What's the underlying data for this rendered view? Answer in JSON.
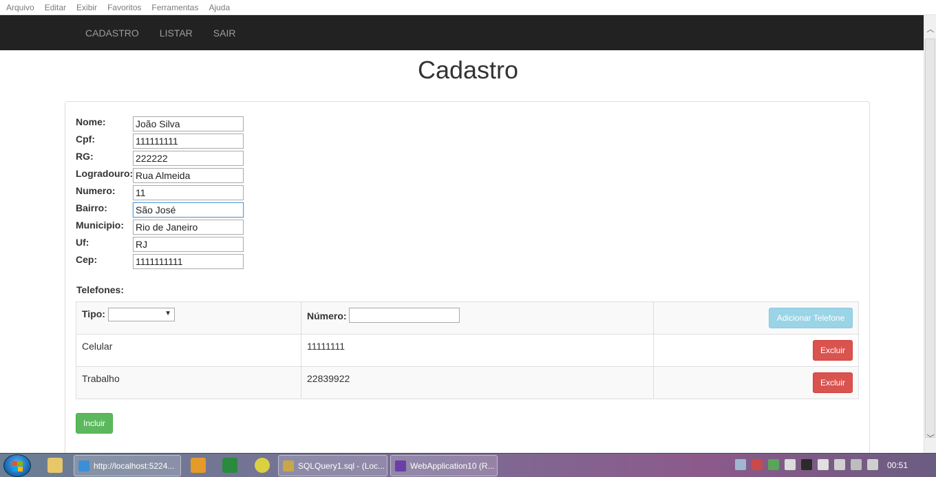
{
  "browser_menu": [
    "Arquivo",
    "Editar",
    "Exibir",
    "Favoritos",
    "Ferramentas",
    "Ajuda"
  ],
  "navbar": {
    "items": [
      "CADASTRO",
      "LISTAR",
      "SAIR"
    ]
  },
  "page_title": "Cadastro",
  "form": {
    "fields": [
      {
        "label": "Nome:",
        "value": "João Silva"
      },
      {
        "label": "Cpf:",
        "value": "111111111"
      },
      {
        "label": "RG:",
        "value": "222222"
      },
      {
        "label": "Logradouro:",
        "value": "Rua Almeida"
      },
      {
        "label": "Numero:",
        "value": "11"
      },
      {
        "label": "Bairro:",
        "value": "São José"
      },
      {
        "label": "Municipio:",
        "value": "Rio de Janeiro"
      },
      {
        "label": "Uf:",
        "value": "RJ"
      },
      {
        "label": "Cep:",
        "value": "1111111111"
      }
    ]
  },
  "telefones": {
    "heading": "Telefones:",
    "tipo_label": "Tipo:",
    "tipo_selected": "",
    "numero_label": "Número:",
    "numero_value": "",
    "add_button": "Adicionar Telefone",
    "rows": [
      {
        "tipo": "Celular",
        "numero": "11111111",
        "action": "Excluir"
      },
      {
        "tipo": "Trabalho",
        "numero": "22839922",
        "action": "Excluir"
      }
    ]
  },
  "submit_button": "Incluir",
  "taskbar": {
    "windows": [
      "http://localhost:5224...",
      "SQLQuery1.sql - (Loc...",
      "WebApplication10 (R..."
    ],
    "clock": "00:51"
  },
  "colors": {
    "navbar_bg": "#222222",
    "danger": "#d9534f",
    "success": "#5cb85c",
    "info": "#9ad4e6"
  }
}
